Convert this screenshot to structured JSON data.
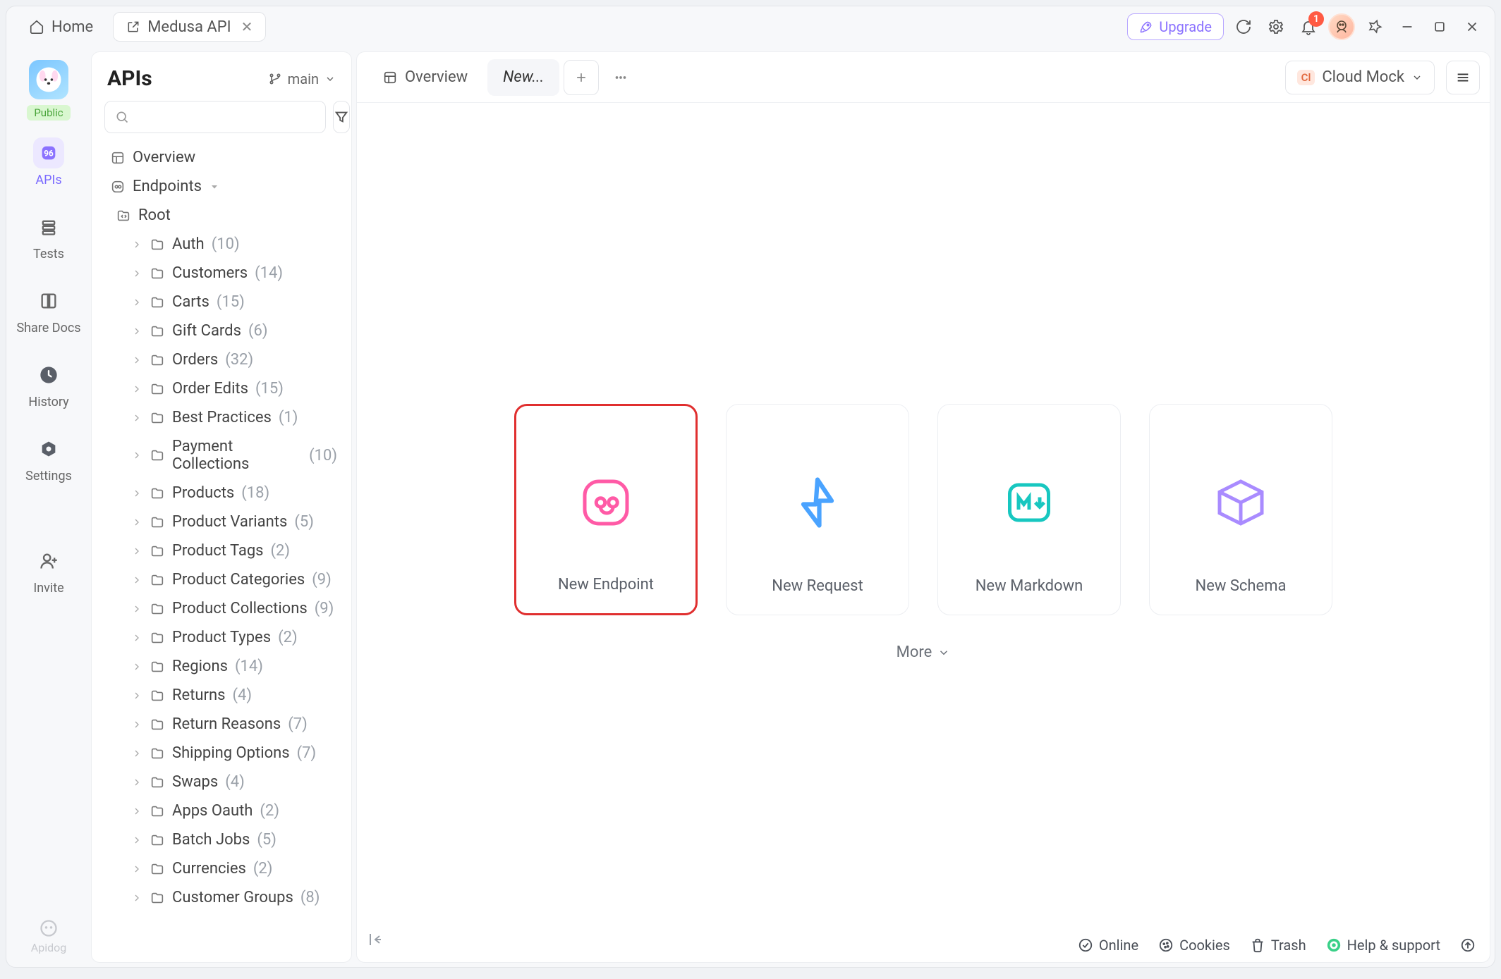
{
  "titlebar": {
    "home_label": "Home",
    "active_tab_label": "Medusa API",
    "upgrade_label": "Upgrade",
    "notification_count": "1"
  },
  "rail": {
    "public_badge": "Public",
    "items": [
      {
        "label": "APIs"
      },
      {
        "label": "Tests"
      },
      {
        "label": "Share Docs"
      },
      {
        "label": "History"
      },
      {
        "label": "Settings"
      }
    ],
    "invite_label": "Invite",
    "footer_label": "Apidog"
  },
  "panel": {
    "title": "APIs",
    "branch_label": "main",
    "overview_label": "Overview",
    "endpoints_label": "Endpoints",
    "root_label": "Root",
    "folders": [
      {
        "name": "Auth",
        "count": "(10)"
      },
      {
        "name": "Customers",
        "count": "(14)"
      },
      {
        "name": "Carts",
        "count": "(15)"
      },
      {
        "name": "Gift Cards",
        "count": "(6)"
      },
      {
        "name": "Orders",
        "count": "(32)"
      },
      {
        "name": "Order Edits",
        "count": "(15)"
      },
      {
        "name": "Best Practices",
        "count": "(1)"
      },
      {
        "name": "Payment Collections",
        "count": "(10)"
      },
      {
        "name": "Products",
        "count": "(18)"
      },
      {
        "name": "Product Variants",
        "count": "(5)"
      },
      {
        "name": "Product Tags",
        "count": "(2)"
      },
      {
        "name": "Product Categories",
        "count": "(9)"
      },
      {
        "name": "Product Collections",
        "count": "(9)"
      },
      {
        "name": "Product Types",
        "count": "(2)"
      },
      {
        "name": "Regions",
        "count": "(14)"
      },
      {
        "name": "Returns",
        "count": "(4)"
      },
      {
        "name": "Return Reasons",
        "count": "(7)"
      },
      {
        "name": "Shipping Options",
        "count": "(7)"
      },
      {
        "name": "Swaps",
        "count": "(4)"
      },
      {
        "name": "Apps Oauth",
        "count": "(2)"
      },
      {
        "name": "Batch Jobs",
        "count": "(5)"
      },
      {
        "name": "Currencies",
        "count": "(2)"
      },
      {
        "name": "Customer Groups",
        "count": "(8)"
      }
    ]
  },
  "main": {
    "tab_overview": "Overview",
    "tab_new": "New...",
    "env_label": "Cloud Mock",
    "env_badge": "Cl",
    "cards": [
      {
        "label": "New Endpoint"
      },
      {
        "label": "New Request"
      },
      {
        "label": "New Markdown"
      },
      {
        "label": "New Schema"
      }
    ],
    "more_label": "More"
  },
  "statusbar": {
    "online": "Online",
    "cookies": "Cookies",
    "trash": "Trash",
    "help": "Help & support"
  },
  "colors": {
    "accent": "#8b72ff",
    "highlight": "#e02f2f"
  }
}
